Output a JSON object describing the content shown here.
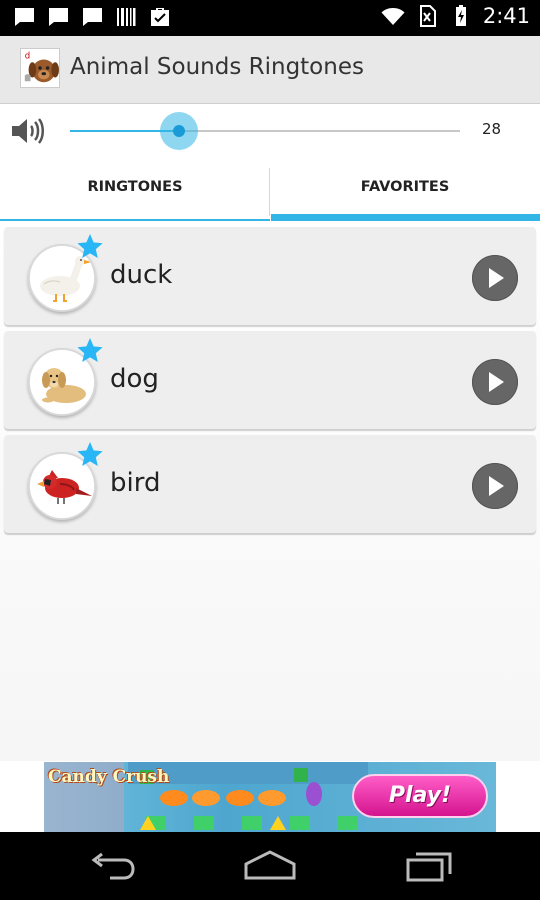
{
  "status_bar": {
    "time": "2:41",
    "icons_left": [
      "message-icon",
      "message-icon",
      "message-icon",
      "barcode-icon",
      "briefcase-check-icon"
    ],
    "icons_right": [
      "wifi-icon",
      "no-sim-icon",
      "battery-charging-icon"
    ]
  },
  "app_bar": {
    "title": "Animal Sounds Ringtones",
    "icon": "app-logo-dog-icon"
  },
  "volume": {
    "icon": "speaker-icon",
    "level_fraction": 0.28,
    "value": "28",
    "accent_color": "#33b5e5"
  },
  "tabs": [
    {
      "label": "RINGTONES",
      "selected": false
    },
    {
      "label": "FAVORITES",
      "selected": true
    }
  ],
  "items": [
    {
      "label": "duck",
      "favorite": true,
      "image": "duck-image"
    },
    {
      "label": "dog",
      "favorite": true,
      "image": "dog-image"
    },
    {
      "label": "bird",
      "favorite": true,
      "image": "bird-image"
    }
  ],
  "ad": {
    "brand": "Candy Crush",
    "button_label": "Play!"
  },
  "nav_bar": {
    "buttons": [
      "back-icon",
      "home-icon",
      "recents-icon"
    ]
  },
  "colors": {
    "accent": "#33b5e5",
    "star": "#29b6f6",
    "play_button": "#666666"
  }
}
